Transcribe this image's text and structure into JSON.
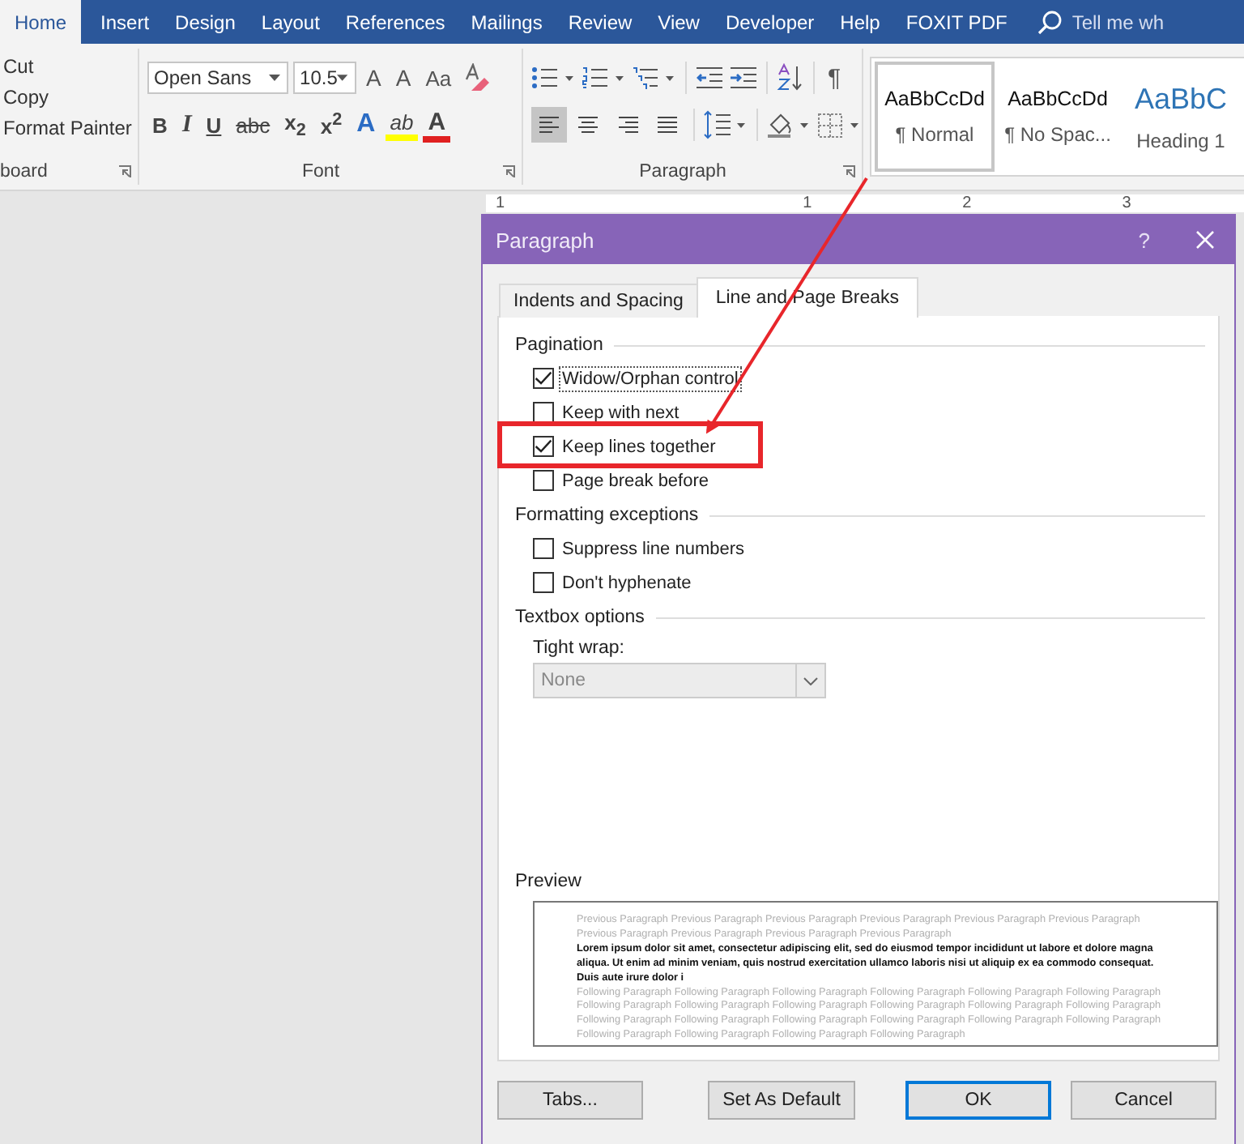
{
  "ribbon_tabs": [
    {
      "label": "Home",
      "selected": true
    },
    {
      "label": "Insert",
      "selected": false
    },
    {
      "label": "Design",
      "selected": false
    },
    {
      "label": "Layout",
      "selected": false
    },
    {
      "label": "References",
      "selected": false
    },
    {
      "label": "Mailings",
      "selected": false
    },
    {
      "label": "Review",
      "selected": false
    },
    {
      "label": "View",
      "selected": false
    },
    {
      "label": "Developer",
      "selected": false
    },
    {
      "label": "Help",
      "selected": false
    },
    {
      "label": "FOXIT PDF",
      "selected": false
    }
  ],
  "tell_me": {
    "placeholder": "Tell me wh"
  },
  "clipboard": {
    "items": [
      "Cut",
      "Copy",
      "Format Painter"
    ],
    "group_label": "board"
  },
  "font": {
    "font_name": "Open Sans",
    "font_size": "10.5",
    "grow_font": "A",
    "shrink_font": "A",
    "change_case": "Aa",
    "buttons": [
      {
        "kind": "bold",
        "label": "B"
      },
      {
        "kind": "italic",
        "label": "I"
      },
      {
        "kind": "underline",
        "label": "U"
      },
      {
        "kind": "strike",
        "label": "abc"
      },
      {
        "kind": "sub",
        "label": "x$_{2}$"
      },
      {
        "kind": "super",
        "label": "x$^{2}$"
      },
      {
        "kind": "effects",
        "label": "A"
      },
      {
        "kind": "highlight",
        "label": "ab"
      },
      {
        "kind": "color",
        "label": "A"
      }
    ],
    "group_label": "Font"
  },
  "paragraph": {
    "show_marks": "¶",
    "alignments": [
      {
        "kind": "left",
        "selected": true
      },
      {
        "kind": "center",
        "selected": false
      },
      {
        "kind": "right",
        "selected": false
      },
      {
        "kind": "justify",
        "selected": false
      }
    ],
    "group_label": "Paragraph"
  },
  "styles": [
    {
      "kind": "body",
      "sample": "AaBbCcDd",
      "name": "¶ Normal",
      "selected": true
    },
    {
      "kind": "body",
      "sample": "AaBbCcDd",
      "name": "¶ No Spac...",
      "selected": false
    },
    {
      "kind": "heading",
      "sample": "AaBbC",
      "name": "Heading 1",
      "selected": false
    }
  ],
  "ruler": {
    "labels": [
      "1",
      "1",
      "2",
      "3"
    ]
  },
  "dialog": {
    "title": "Paragraph",
    "help": "?",
    "tabs": [
      {
        "label": "Indents and Spacing",
        "selected": false
      },
      {
        "label": "Line and Page Breaks",
        "selected": true
      }
    ],
    "sections": [
      {
        "kind": "checks",
        "title": "Pagination",
        "options": [
          {
            "label": "Widow/Orphan control",
            "checked": true,
            "focused": true
          },
          {
            "label": "Keep with next",
            "checked": false,
            "focused": false
          },
          {
            "label": "Keep lines together",
            "checked": true,
            "focused": false
          },
          {
            "label": "Page break before",
            "checked": false,
            "focused": false
          }
        ]
      },
      {
        "kind": "checks",
        "title": "Formatting exceptions",
        "options": [
          {
            "label": "Suppress line numbers",
            "checked": false,
            "focused": false
          },
          {
            "label": "Don't hyphenate",
            "checked": false,
            "focused": false
          }
        ]
      },
      {
        "kind": "dropdown",
        "title": "Textbox options",
        "field": {
          "label": "Tight wrap:",
          "value": "None",
          "disabled": true
        }
      }
    ],
    "preview": {
      "title": "Preview",
      "previous": "Previous Paragraph Previous Paragraph Previous Paragraph Previous Paragraph Previous Paragraph Previous Paragraph Previous Paragraph Previous Paragraph Previous Paragraph Previous Paragraph",
      "current": "Lorem ipsum dolor sit amet, consectetur adipiscing elit, sed do eiusmod tempor incididunt ut labore et dolore magna aliqua. Ut enim ad minim veniam, quis nostrud exercitation ullamco laboris nisi ut aliquip ex ea commodo consequat. Duis aute irure dolor i",
      "following": "Following Paragraph Following Paragraph Following Paragraph Following Paragraph Following Paragraph Following Paragraph Following Paragraph Following Paragraph Following Paragraph Following Paragraph Following Paragraph Following Paragraph Following Paragraph Following Paragraph Following Paragraph Following Paragraph Following Paragraph Following Paragraph Following Paragraph Following Paragraph Following Paragraph Following Paragraph"
    },
    "buttons": [
      {
        "label": "Tabs...",
        "default": false
      },
      {
        "label": "Set As Default",
        "default": false
      },
      {
        "label": "OK",
        "default": true
      },
      {
        "label": "Cancel",
        "default": false
      }
    ]
  }
}
